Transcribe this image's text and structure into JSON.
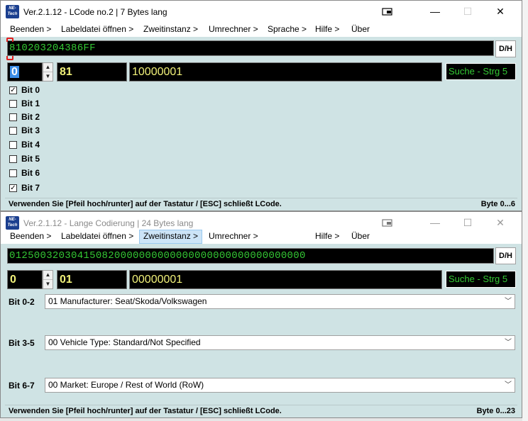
{
  "window1": {
    "title": "Ver.2.1.12 - LCode no.2 | 7 Bytes lang",
    "logo_text": "NE-Tech",
    "controls": {
      "pin": "pin-icon",
      "minimize": "—",
      "maximize": "☐",
      "close": "✕"
    },
    "menu": [
      "Beenden >",
      "Labeldatei öffnen >",
      "Zweitinstanz >",
      "Umrechner >",
      "Sprache >",
      "Hilfe >",
      "Über"
    ],
    "hex_value": "810203204386FF",
    "dh_label": "D/H",
    "byte_index": "0",
    "byte_hex": "81",
    "byte_binary": "10000001",
    "search_label": "Suche - Strg 5",
    "bits": [
      {
        "label": "Bit 0",
        "checked": true
      },
      {
        "label": "Bit 1",
        "checked": false
      },
      {
        "label": "Bit 2",
        "checked": false
      },
      {
        "label": "Bit 3",
        "checked": false
      },
      {
        "label": "Bit 4",
        "checked": false
      },
      {
        "label": "Bit 5",
        "checked": false
      },
      {
        "label": "Bit 6",
        "checked": false
      },
      {
        "label": "Bit 7",
        "checked": true
      }
    ],
    "status_left": "Verwenden Sie [Pfeil hoch/runter] auf der Tastatur / [ESC] schließt LCode.",
    "status_right": "Byte 0...6"
  },
  "window2": {
    "title": "Ver.2.1.12 - Lange Codierung | 24 Bytes lang",
    "logo_text": "NE-Tech",
    "controls": {
      "pin": "pin-icon",
      "minimize": "—",
      "maximize": "☐",
      "close": "✕"
    },
    "menu": [
      "Beenden >",
      "Labeldatei öffnen >",
      "Zweitinstanz >",
      "Umrechner >",
      "Hilfe >",
      "Über"
    ],
    "active_menu": "Zweitinstanz >",
    "hex_value": "012500320304150820000000000000000000000000000000",
    "dh_label": "D/H",
    "byte_index": "0",
    "byte_hex": "01",
    "byte_binary": "00000001",
    "search_label": "Suche - Strg 5",
    "groups": [
      {
        "label": "Bit 0-2",
        "value": "01 Manufacturer: Seat/Skoda/Volkswagen"
      },
      {
        "label": "Bit 3-5",
        "value": "00 Vehicle Type: Standard/Not Specified"
      },
      {
        "label": "Bit 6-7",
        "value": "00 Market: Europe / Rest of World (RoW)"
      }
    ],
    "status_left": "Verwenden Sie [Pfeil hoch/runter] auf der Tastatur / [ESC] schließt LCode.",
    "status_right": "Byte 0...23"
  },
  "colors": {
    "panel_bg": "#cfe3e4",
    "hex_text": "#34c934",
    "value_text": "#f2f27a",
    "marker_red": "#e01e1e",
    "selection_blue": "#3b8ee8"
  }
}
